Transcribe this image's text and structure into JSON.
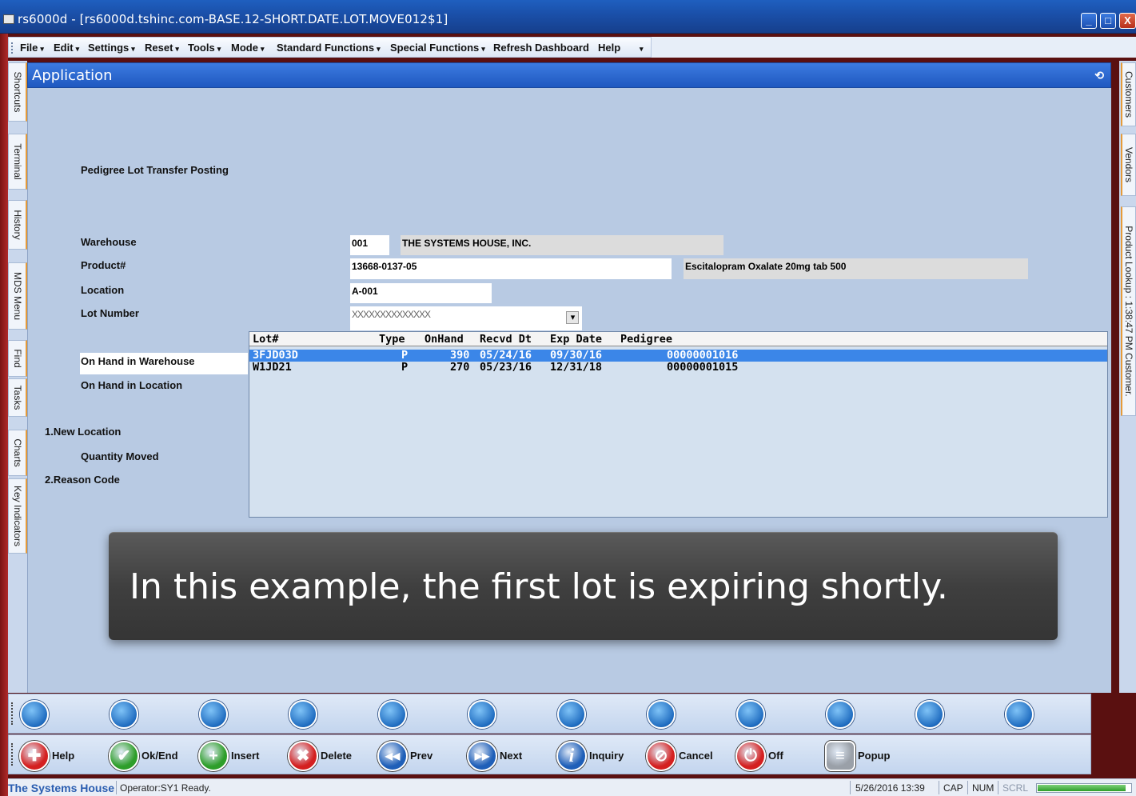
{
  "window": {
    "title": "rs6000d - [rs6000d.tshinc.com-BASE.12-SHORT.DATE.LOT.MOVE012$1]",
    "minimize": "_",
    "maximize": "□",
    "close": "X"
  },
  "menu": [
    {
      "label": "File",
      "caret": "▾"
    },
    {
      "label": "Edit",
      "caret": "▾"
    },
    {
      "label": "Settings",
      "caret": "▾"
    },
    {
      "label": "Reset",
      "caret": "▾"
    },
    {
      "label": "Tools",
      "caret": "▾"
    },
    {
      "label": "Mode",
      "caret": "▾"
    },
    {
      "label": "Standard Functions",
      "caret": "▾"
    },
    {
      "label": "Special Functions",
      "caret": "▾"
    },
    {
      "label": "Refresh Dashboard",
      "caret": ""
    },
    {
      "label": "Help",
      "caret": ""
    },
    {
      "label": "",
      "caret": "▾"
    }
  ],
  "left_tabs": [
    "Shortcuts",
    "Terminal",
    "History",
    "MDS Menu",
    "Find",
    "Tasks",
    "Charts",
    "Key Indicators"
  ],
  "right_tabs": [
    "Customers",
    "Vendors",
    "Product Lookup : 1:38:47 PM Customer."
  ],
  "app": {
    "title": "Application",
    "restore_icon": "restore-icon",
    "heading": "Pedigree Lot Transfer Posting",
    "labels": {
      "warehouse": "Warehouse",
      "product": "Product#",
      "location": "Location",
      "lot_number": "Lot Number",
      "on_hand_warehouse": "On Hand in Warehouse",
      "on_hand_location": "On Hand in Location",
      "new_location": "1.New Location",
      "quantity_moved": "Quantity Moved",
      "reason_code": "2.Reason Code"
    },
    "values": {
      "warehouse_code": "001",
      "warehouse_name": "THE SYSTEMS HOUSE, INC.",
      "product_code": "13668-0137-05",
      "product_desc": "Escitalopram Oxalate 20mg tab 500",
      "location": "A-001",
      "lot_number": "XXXXXXXXXXXXXX",
      "lot_dropdown_arrow": "▾"
    }
  },
  "lot_grid": {
    "columns": [
      "Lot#",
      "Type",
      "OnHand",
      "Recvd Dt",
      "Exp Date",
      "Pedigree"
    ],
    "rows": [
      {
        "lot": "3FJD03D",
        "type": "P",
        "onhand": "390",
        "recvd": "05/24/16",
        "exp": "09/30/16",
        "pedigree": "00000001016",
        "selected": true
      },
      {
        "lot": "W1JD21",
        "type": "P",
        "onhand": "270",
        "recvd": "05/23/16",
        "exp": "12/31/18",
        "pedigree": "00000001015",
        "selected": false
      }
    ]
  },
  "caption": "In this example, the first lot is expiring shortly.",
  "function_keys": [
    {
      "label": "Help",
      "icon": "lifebuoy-icon",
      "color": "#d42020",
      "glyph": "✚"
    },
    {
      "label": "Ok/End",
      "icon": "checkmark-icon",
      "color": "#2e9e2a",
      "glyph": "✔"
    },
    {
      "label": "Insert",
      "icon": "plus-icon",
      "color": "#2e9e2a",
      "glyph": "+"
    },
    {
      "label": "Delete",
      "icon": "x-icon",
      "color": "#d42020",
      "glyph": "✖"
    },
    {
      "label": "Prev",
      "icon": "rewind-icon",
      "color": "#1f5fb8",
      "glyph": "◀◀"
    },
    {
      "label": "Next",
      "icon": "fast-forward-icon",
      "color": "#1f5fb8",
      "glyph": "▶▶"
    },
    {
      "label": "Inquiry",
      "icon": "info-icon",
      "color": "#1f5fb8",
      "glyph": "i"
    },
    {
      "label": "Cancel",
      "icon": "cancel-icon",
      "color": "#d42020",
      "glyph": "⊘"
    },
    {
      "label": "Off",
      "icon": "power-icon",
      "color": "#d42020",
      "glyph": "⏻"
    },
    {
      "label": "Popup",
      "icon": "database-icon",
      "color": "#9aa0a8",
      "glyph": "≡"
    }
  ],
  "status": {
    "company": "The Systems House",
    "message": "Operator:SY1 Ready.",
    "datetime": "5/26/2016 13:39",
    "cap": "CAP",
    "num": "NUM",
    "scrl": "SCRL",
    "progress": 0.95
  }
}
